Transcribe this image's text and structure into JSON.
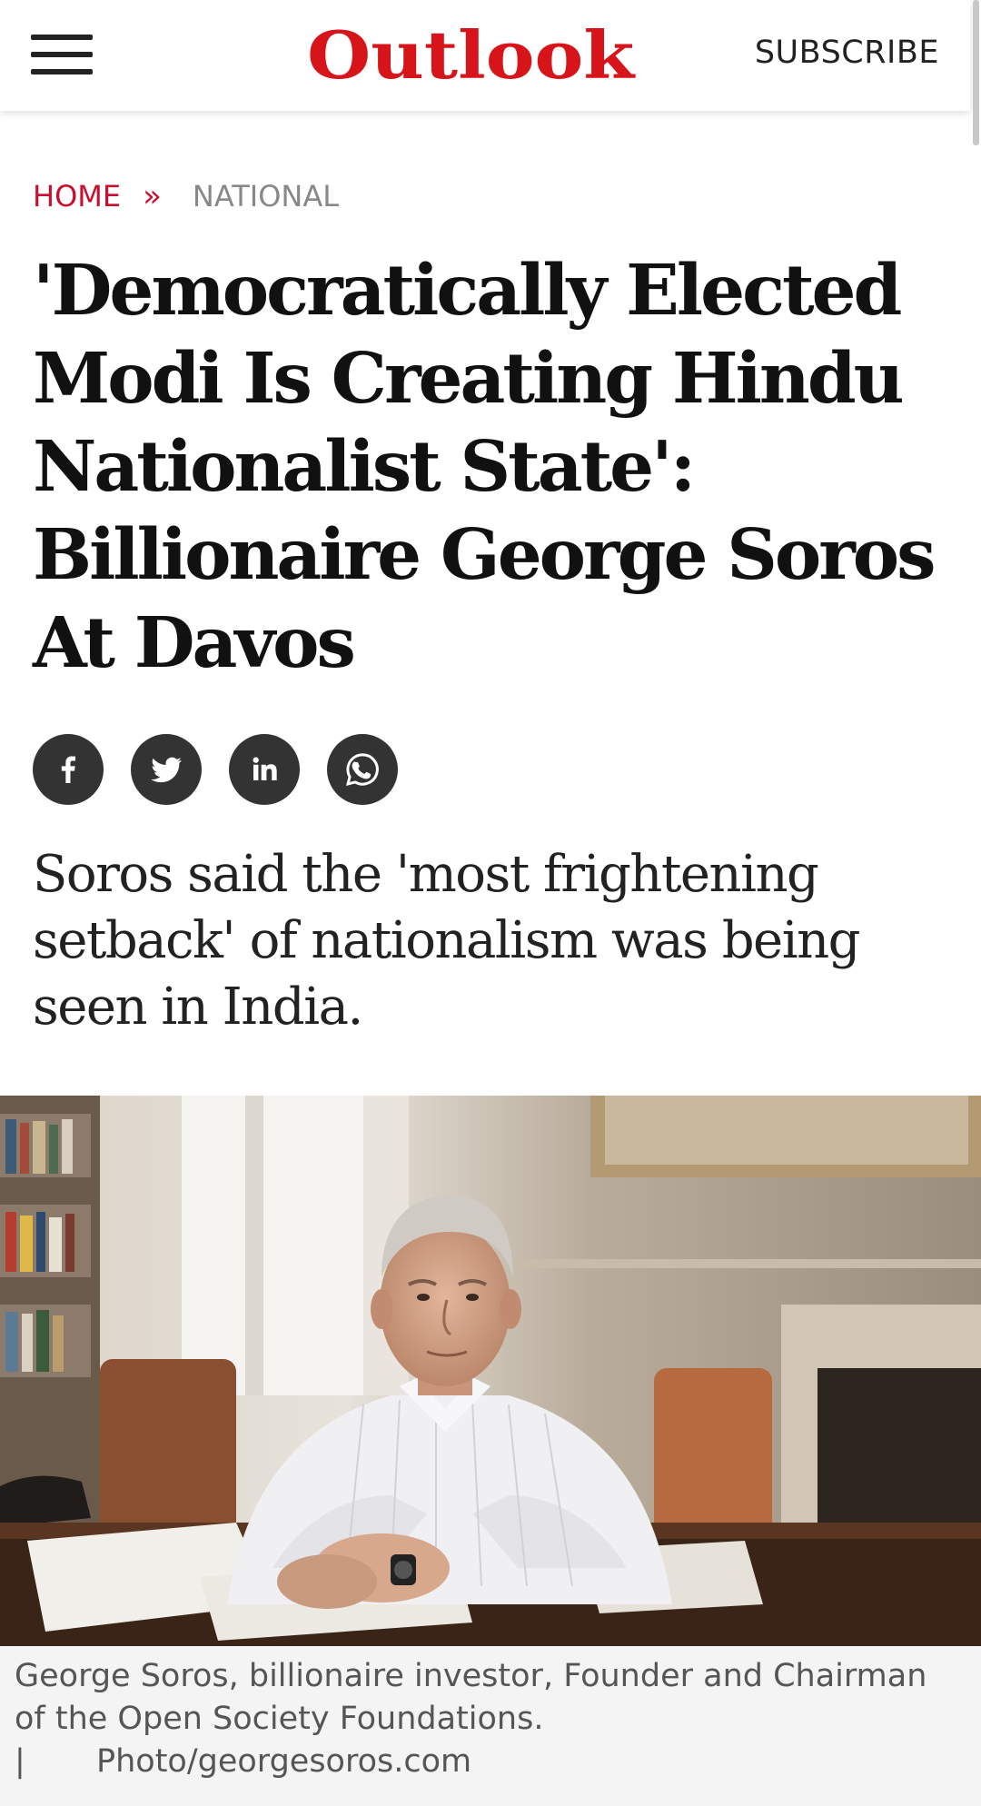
{
  "header": {
    "logo": "Outlook",
    "subscribe_label": "SUBSCRIBE",
    "menu_icon": "hamburger-menu-icon"
  },
  "breadcrumb": {
    "home": "HOME",
    "separator": "»",
    "current": "NATIONAL"
  },
  "article": {
    "headline": "'Democratically Elected Modi Is Creating Hindu Nationalist State': Billionaire George Soros At Davos",
    "subheadline": "Soros said the 'most frightening setback' of nationalism was being seen in India."
  },
  "share": {
    "icons": [
      "facebook-icon",
      "twitter-icon",
      "linkedin-icon",
      "whatsapp-icon"
    ]
  },
  "photo": {
    "caption": "George Soros, billionaire investor, Founder and Chairman of the Open Society Foundations.",
    "credit_separator": "|",
    "credit": "Photo/georgesoros.com"
  },
  "colors": {
    "brand_red": "#d7141a",
    "breadcrumb_red": "#c8102e",
    "share_icon_bg": "#333333",
    "caption_bg": "#f4f4f4"
  }
}
